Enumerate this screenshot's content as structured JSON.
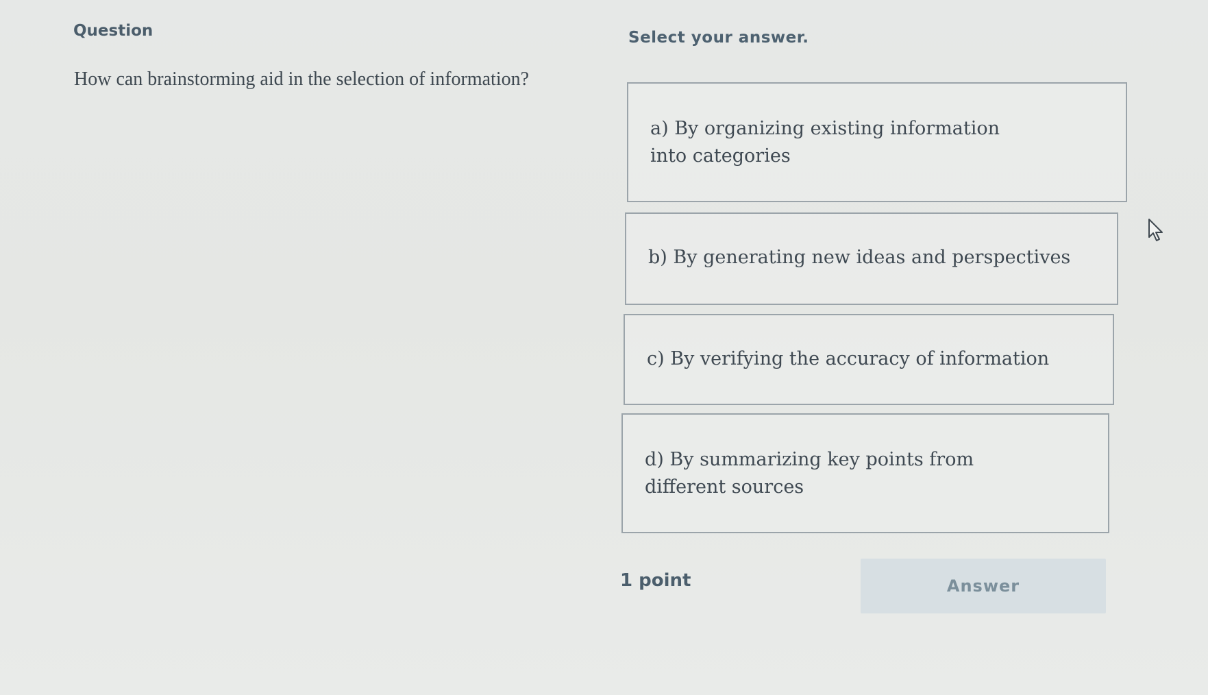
{
  "question": {
    "label": "Question",
    "text": "How can brainstorming aid in the selection of information?"
  },
  "answers": {
    "prompt": "Select your answer.",
    "options": [
      {
        "text": "a) By organizing existing information into categories"
      },
      {
        "text": "b) By generating new ideas and perspectives"
      },
      {
        "text": "c) By verifying the accuracy of information"
      },
      {
        "text": "d) By summarizing key points from different sources"
      }
    ]
  },
  "footer": {
    "points": "1 point",
    "answer_button": "Answer"
  },
  "icons": {
    "cursor": "mouse-pointer-icon"
  },
  "colors": {
    "background": "#e6e8e7",
    "option_border": "#9ba4aa",
    "button_bg": "#d7dfe3",
    "button_text": "#7b8f9b",
    "label_text": "#4b5d6b"
  }
}
